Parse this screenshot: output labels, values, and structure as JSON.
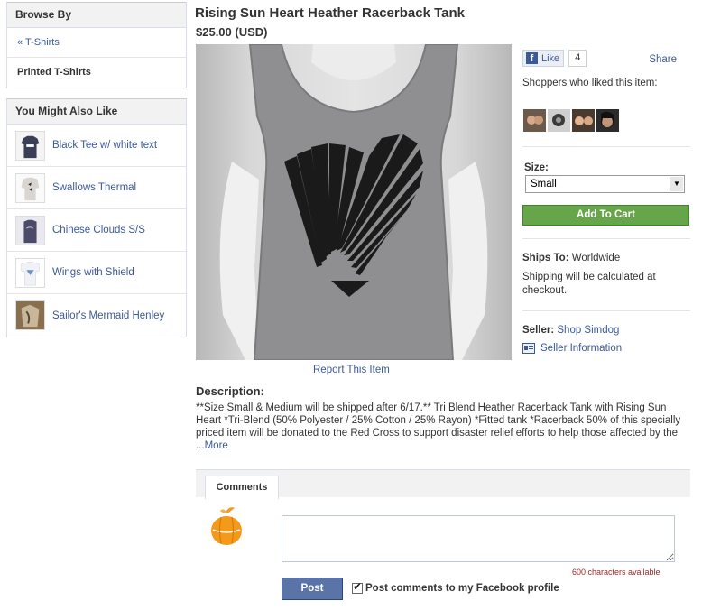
{
  "sidebar": {
    "browse_heading": "Browse By",
    "back_link": "« T-Shirts",
    "current_category": "Printed T-Shirts",
    "also_like_heading": "You Might Also Like",
    "also_like_items": [
      {
        "label": "Black Tee w/ white text",
        "color": "#3a3f55"
      },
      {
        "label": "Swallows Thermal",
        "color": "#d9d6d2"
      },
      {
        "label": "Chinese Clouds S/S",
        "color": "#4b4a68"
      },
      {
        "label": "Wings with Shield",
        "color": "#f0f2f6"
      },
      {
        "label": "Sailor's Mermaid Henley",
        "color": "#8a6f4e"
      }
    ]
  },
  "product": {
    "title": "Rising Sun Heart Heather Racerback Tank",
    "price": "$25.00 (USD)",
    "report_link": "Report This Item"
  },
  "social": {
    "like_label": "Like",
    "like_icon": "facebook-f-icon",
    "like_count": "4",
    "share_label": "Share",
    "shoppers_text": "Shoppers who liked this item:"
  },
  "purchase": {
    "size_label": "Size:",
    "size_selected": "Small",
    "add_to_cart": "Add To Cart"
  },
  "shipping": {
    "ships_to_label": "Ships To:",
    "ships_to_value": "Worldwide",
    "note": "Shipping will be calculated at checkout."
  },
  "seller": {
    "label": "Seller:",
    "name": "Shop Simdog",
    "info_link": "Seller Information"
  },
  "description": {
    "label": "Description:",
    "text": "**Size Small & Medium will be shipped after 6/17.** Tri Blend Heather Racerback Tank with Rising Sun Heart *Tri-Blend (50% Polyester / 25% Cotton / 25% Rayon) *Fitted tank *Racerback 50% of this specially priced item will be donated to the Red Cross to support disaster relief efforts to help those affected by the ...",
    "more_link": "More"
  },
  "comments": {
    "tab_label": "Comments",
    "chars_available": "600 characters available",
    "post_button": "Post",
    "post_to_profile": "Post comments to my Facebook profile"
  },
  "colors": {
    "link": "#3b5998",
    "cart_green": "#67a54b",
    "post_blue": "#5b74a8"
  }
}
